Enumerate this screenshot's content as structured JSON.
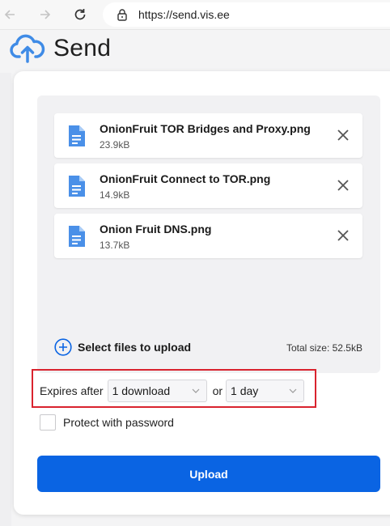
{
  "browser": {
    "url": "https://send.vis.ee",
    "back_icon": "arrow-left",
    "forward_icon": "arrow-right",
    "reload_icon": "reload"
  },
  "app": {
    "name": "Send",
    "logo_icon": "cloud-upload",
    "accent_color": "#0a64e3",
    "logo_color": "#3f8be6"
  },
  "files": [
    {
      "name": "OnionFruit TOR Bridges and Proxy.png",
      "size": "23.9kB"
    },
    {
      "name": "OnionFruit Connect to TOR.png",
      "size": "14.9kB"
    },
    {
      "name": "Onion Fruit DNS.png",
      "size": "13.7kB"
    }
  ],
  "upload_area": {
    "select_label": "Select files to upload",
    "total_size": "Total size: 52.5kB"
  },
  "expiry": {
    "label": "Expires after",
    "downloads_value": "1 download",
    "or_label": "or",
    "time_value": "1 day",
    "highlight_color": "#d9232e"
  },
  "password": {
    "label": "Protect with password",
    "checked": false
  },
  "upload_button": {
    "label": "Upload"
  }
}
